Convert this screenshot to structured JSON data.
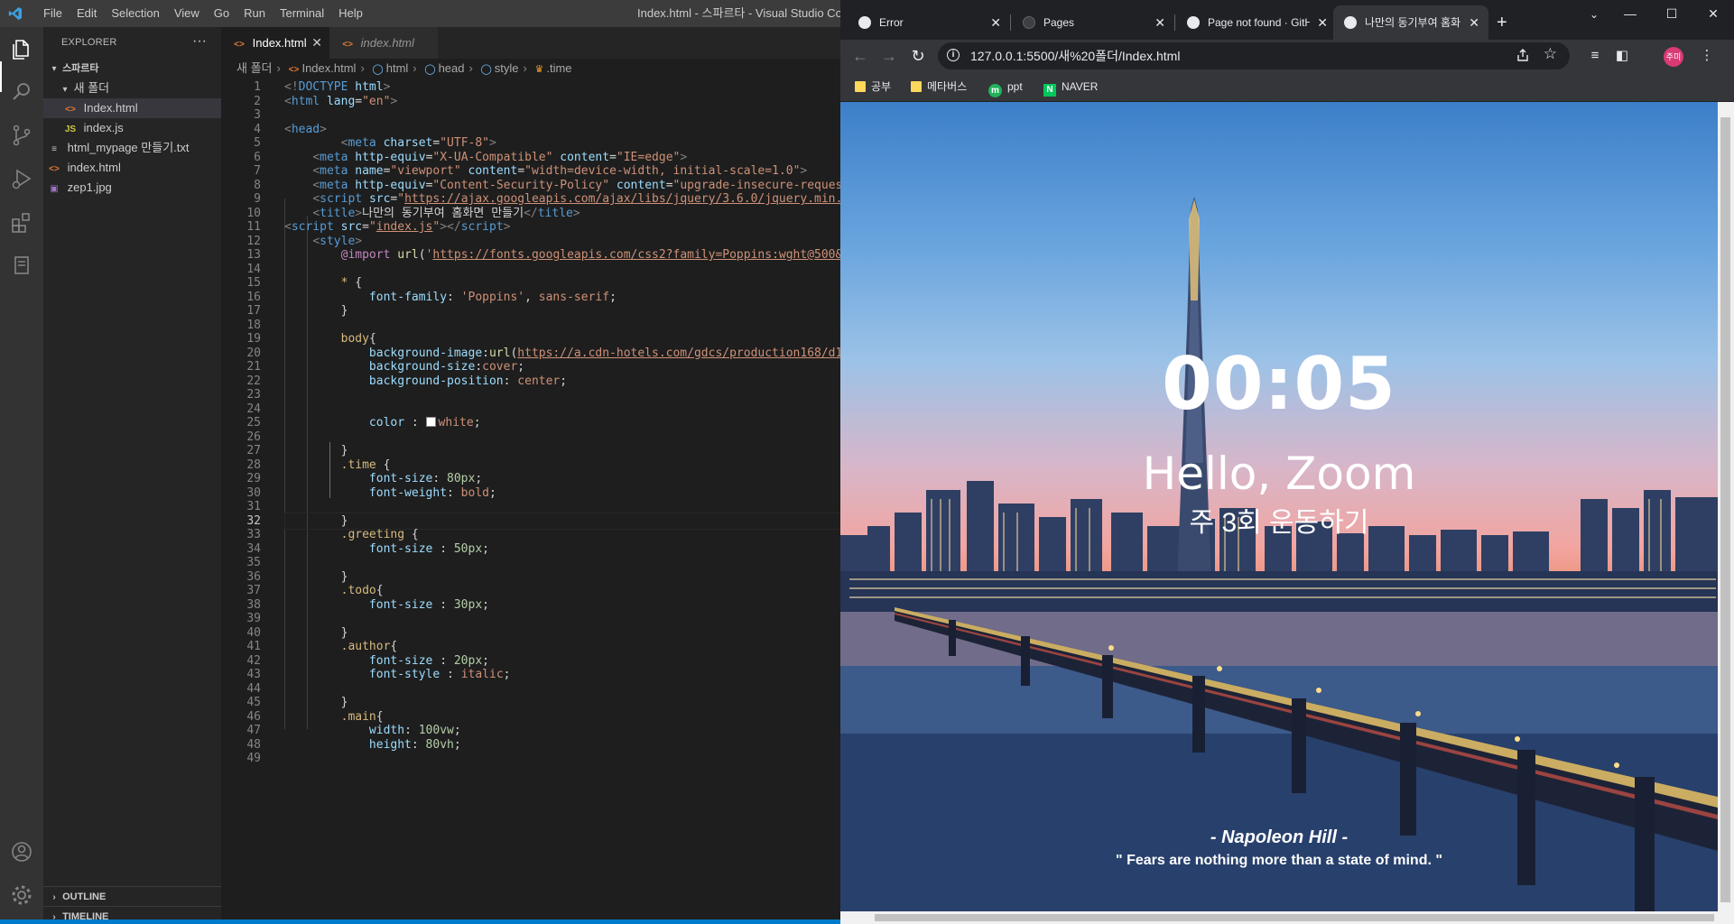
{
  "vscode": {
    "title": "Index.html - 스파르타 - Visual Studio Code",
    "menu": [
      "File",
      "Edit",
      "Selection",
      "View",
      "Go",
      "Run",
      "Terminal",
      "Help"
    ],
    "explorer": {
      "header": "EXPLORER",
      "more": "···",
      "root": "스파르타",
      "folder": "새 폴더",
      "files": [
        {
          "name": "Index.html",
          "type": "html"
        },
        {
          "name": "index.js",
          "type": "js"
        },
        {
          "name": "html_mypage 만들기.txt",
          "type": "txt"
        },
        {
          "name": "index.html",
          "type": "html"
        },
        {
          "name": "zep1.jpg",
          "type": "img"
        }
      ],
      "outline": "OUTLINE",
      "timeline": "TIMELINE"
    },
    "tabs": [
      {
        "label": "Index.html",
        "active": true
      },
      {
        "label": "index.html",
        "active": false
      }
    ],
    "breadcrumb": [
      "새 폴더",
      "Index.html",
      "html",
      "head",
      "style",
      ".time"
    ],
    "active_line": 32
  },
  "chrome": {
    "tabs": [
      {
        "label": "Error"
      },
      {
        "label": "Pages"
      },
      {
        "label": "Page not found · GitHub"
      },
      {
        "label": "나만의 동기부여 홈화면 만들기",
        "active": true
      }
    ],
    "new_tab": "+",
    "url": "127.0.0.1:5500/새%20폴더/Index.html",
    "profile_initials": "주미",
    "bookmarks": [
      {
        "label": "공부",
        "icon": "folder"
      },
      {
        "label": "메타버스",
        "icon": "folder"
      },
      {
        "label": "ppt",
        "icon": "ppt"
      },
      {
        "label": "NAVER",
        "icon": "naver"
      }
    ]
  },
  "page": {
    "time": "00:05",
    "greeting": "Hello, Zoom",
    "todo": "주 3회 운동하기",
    "author": "- Napoleon Hill -",
    "quote": "\" Fears are nothing more than a state of mind. \""
  },
  "colors": {
    "vscode_accent": "#007acc",
    "chrome_frame": "#202124",
    "avatar": "#d93a75"
  }
}
